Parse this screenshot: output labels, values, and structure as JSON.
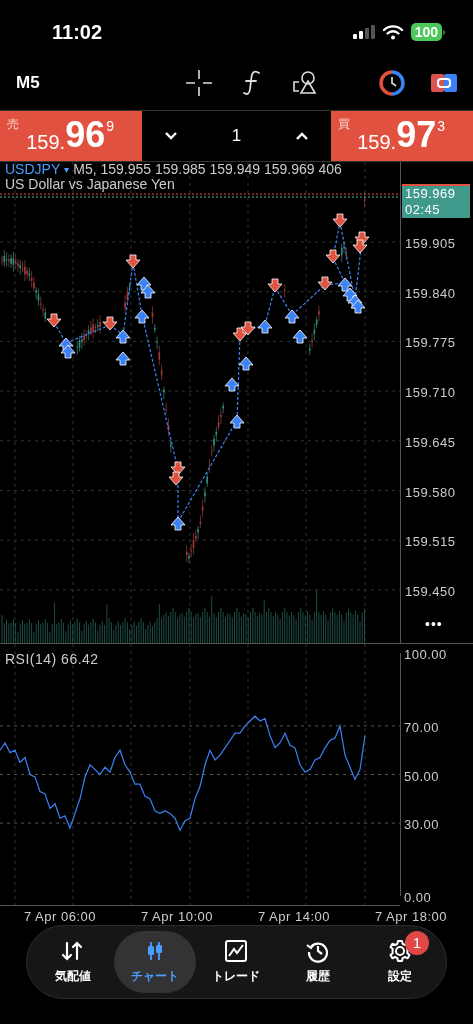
{
  "status_bar": {
    "time": "11:02",
    "battery": "100"
  },
  "toolbar": {
    "timeframe": "M5"
  },
  "quote": {
    "sell": {
      "label": "売",
      "price_prefix": "159.",
      "price_big": "96",
      "price_sup": "9"
    },
    "volume": "1",
    "buy": {
      "label": "買",
      "price_prefix": "159.",
      "price_big": "97",
      "price_sup": "3"
    }
  },
  "chart": {
    "symbol": "USDJPY",
    "caret": "▾",
    "ohlc": "M5, 159.955 159.985 159.949 159.969 406",
    "description": "US Dollar vs Japanese Yen",
    "price_tag": {
      "price": "159.969",
      "countdown": "02:45"
    },
    "price_axis": [
      "159.905",
      "159.840",
      "159.775",
      "159.710",
      "159.645",
      "159.580",
      "159.515",
      "159.450"
    ],
    "more": "•••"
  },
  "rsi": {
    "current_value": "66.42",
    "chart_data": {
      "type": "line",
      "ylim": [
        0,
        100
      ],
      "grid": true,
      "yticks": [
        {
          "value": 100,
          "label": "100.00"
        },
        {
          "value": 70,
          "label": "70.00"
        },
        {
          "value": 50,
          "label": "50.00"
        },
        {
          "value": 30,
          "label": "30.00"
        },
        {
          "value": 0,
          "label": "0.00"
        }
      ],
      "series": [
        {
          "name": "RSI(14)",
          "color": "#3b82f6",
          "values": [
            60,
            63,
            59,
            60,
            55,
            57,
            50,
            49,
            43,
            42,
            36,
            38,
            32,
            33,
            28,
            34,
            40,
            49,
            54,
            52,
            50,
            53,
            51,
            57,
            60,
            54,
            51,
            46,
            46,
            41,
            40,
            35,
            34,
            35,
            34,
            32,
            27,
            31,
            32,
            40,
            45,
            54,
            60,
            56,
            58,
            61,
            64,
            67,
            67,
            70,
            72,
            74,
            72,
            73,
            66,
            61,
            63,
            67,
            62,
            61,
            54,
            51,
            52,
            56,
            57,
            61,
            64,
            65,
            70,
            58,
            53,
            48,
            52,
            66
          ]
        }
      ]
    }
  },
  "time_axis": [
    "7 Apr 06:00",
    "7 Apr 10:00",
    "7 Apr 14:00",
    "7 Apr 18:00"
  ],
  "nav": [
    {
      "kind": "quotes",
      "label": "気配値",
      "selected": false
    },
    {
      "kind": "chart",
      "label": "チャート",
      "selected": true
    },
    {
      "kind": "trade",
      "label": "トレード",
      "selected": false
    },
    {
      "kind": "history",
      "label": "履歴",
      "selected": false
    },
    {
      "kind": "settings",
      "label": "設定",
      "selected": false,
      "badge": "1"
    }
  ]
}
